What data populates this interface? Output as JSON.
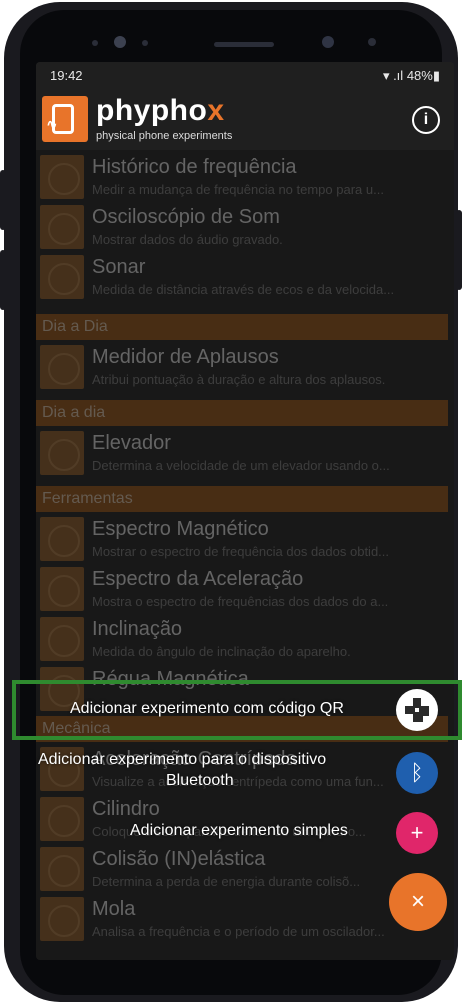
{
  "status": {
    "time": "19:42",
    "battery": "48%"
  },
  "app": {
    "name_main": "phypho",
    "name_x": "x",
    "subtitle": "physical phone experiments"
  },
  "items": [
    {
      "title": "Histórico de frequência",
      "desc": "Medir a mudança de frequência no tempo para u..."
    },
    {
      "title": "Osciloscópio de Som",
      "desc": "Mostrar dados do áudio gravado."
    },
    {
      "title": "Sonar",
      "desc": "Medida de distância através de ecos e da velocida..."
    }
  ],
  "categories": {
    "dia_a_dia_1": "Dia a Dia",
    "dia_a_dia_2": "Dia a dia",
    "ferramentas": "Ferramentas",
    "mecanica": "Mecânica"
  },
  "items_dia1": [
    {
      "title": "Medidor de Aplausos",
      "desc": "Atribui pontuação à duração e altura dos aplausos."
    }
  ],
  "items_dia2": [
    {
      "title": "Elevador",
      "desc": "Determina a velocidade de um elevador usando o..."
    }
  ],
  "items_ferr": [
    {
      "title": "Espectro Magnético",
      "desc": "Mostrar o espectro de frequência dos dados obtid..."
    },
    {
      "title": "Espectro da Aceleração",
      "desc": "Mostra o espectro de frequências dos dados do a..."
    },
    {
      "title": "Inclinação",
      "desc": "Medida do ângulo de inclinação do aparelho."
    },
    {
      "title": "Régua Magnética",
      "desc": ""
    }
  ],
  "items_mec": [
    {
      "title": "Aceleração Centrípeda",
      "desc": "Visualize a aceleração centrípeda como uma fun..."
    },
    {
      "title": "Cilindro",
      "desc": "Coloque o seu aparelho dentro de um cilindro..."
    },
    {
      "title": "Colisão (IN)elástica",
      "desc": "Determina a perda de energia durante colisõ..."
    },
    {
      "title": "Mola",
      "desc": "Analisa a frequência e o período de um oscilador..."
    }
  ],
  "fab": {
    "qr_label": "Adicionar experimento com código QR",
    "bt_label_1": "Adicionar experimento para o dispositivo",
    "bt_label_2": "Bluetooth",
    "simple_label": "Adicionar experimento simples",
    "close_symbol": "×",
    "plus_symbol": "+",
    "bt_symbol": "ᛒ",
    "colors": {
      "qr": "#ffffff",
      "bluetooth": "#1f5fae",
      "simple": "#e0266a",
      "main": "#e8742a"
    }
  }
}
